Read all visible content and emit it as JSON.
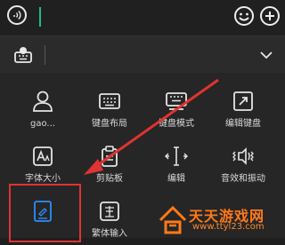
{
  "input_bar": {
    "voice_icon": "voice-icon",
    "emoji_icon": "emoji-icon",
    "add_icon": "plus-icon"
  },
  "toolbar": {
    "keyboard_icon": "keyboard-settings-icon",
    "collapse_icon": "chevron-down-icon"
  },
  "grid": {
    "items": [
      {
        "label": "gao...",
        "icon": "person-icon"
      },
      {
        "label": "键盘布局",
        "icon": "keyboard-layout-icon"
      },
      {
        "label": "键盘模式",
        "icon": "keyboard-mode-icon"
      },
      {
        "label": "编辑键盘",
        "icon": "edit-keyboard-icon"
      },
      {
        "label": "字体大小",
        "icon": "font-size-icon"
      },
      {
        "label": "剪贴板",
        "icon": "clipboard-icon"
      },
      {
        "label": "编辑",
        "icon": "cursor-edit-icon"
      },
      {
        "label": "音效和振动",
        "icon": "sound-vibration-icon"
      },
      {
        "label": "",
        "icon": "handwriting-icon"
      },
      {
        "label": "繁体输入",
        "icon": "traditional-chinese-icon"
      }
    ]
  },
  "watermark": {
    "title": "天天游戏网",
    "url": "www.ttyl23.com"
  },
  "colors": {
    "accent": "#1fbf86",
    "highlight": "#e03333",
    "active_blue": "#2a8fff",
    "watermark": "#ff7a18"
  }
}
